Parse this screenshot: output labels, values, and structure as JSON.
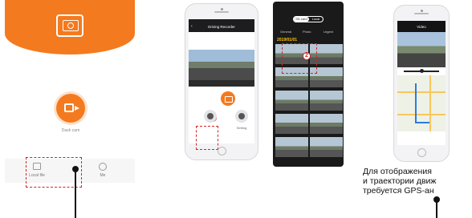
{
  "app_home": {
    "dash_cam_label": "Dash cam",
    "tabs": [
      {
        "label": "Local file",
        "icon": "image-icon"
      },
      {
        "label": "Me",
        "icon": "person-icon"
      }
    ],
    "accent": "#f47a1f"
  },
  "recorder": {
    "title": "Driving Recorder",
    "badge": "1",
    "function_labels": [
      "",
      "Setting"
    ]
  },
  "gallery": {
    "segment": [
      "SD card",
      "Local"
    ],
    "tabs": [
      "General",
      "Photo",
      "Urgent"
    ],
    "date": "2019/01/01",
    "badge": "2"
  },
  "playback": {
    "title": "Video"
  },
  "caption": {
    "lines": [
      "Для отображения",
      "и траектории движ",
      "требуется GPS-ан"
    ]
  },
  "colors": {
    "highlight": "#d42424",
    "route": "#2a7be4"
  }
}
